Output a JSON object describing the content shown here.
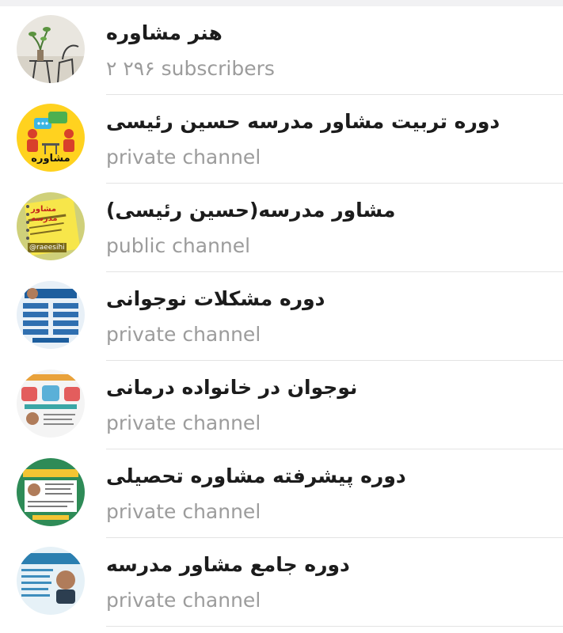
{
  "channels": [
    {
      "title": "هنر مشاوره",
      "subtitle": "۲ ۲۹۶ subscribers",
      "avatar_icon": "plant-cafe-icon"
    },
    {
      "title": "دوره تربیت مشاور مدرسه حسین رئیسی",
      "subtitle": "private channel",
      "avatar_icon": "counseling-logo-icon",
      "avatar_caption": "مشاوره"
    },
    {
      "title": "مشاور مدرسه(حسین رئیسی)",
      "subtitle": "public channel",
      "avatar_icon": "notebook-icon",
      "avatar_caption": "مشاور مدرسه",
      "avatar_handle": "@raeesihi"
    },
    {
      "title": "دوره مشکلات نوجوانی",
      "subtitle": "private channel",
      "avatar_icon": "course-poster-icon"
    },
    {
      "title": "نوجوان در خانواده درمانی",
      "subtitle": "private channel",
      "avatar_icon": "family-therapy-poster-icon"
    },
    {
      "title": "دوره پیشرفته مشاوره تحصیلی",
      "subtitle": "private channel",
      "avatar_icon": "green-course-poster-icon"
    },
    {
      "title": "دوره جامع مشاور مدرسه",
      "subtitle": "private channel",
      "avatar_icon": "comprehensive-course-poster-icon"
    }
  ]
}
